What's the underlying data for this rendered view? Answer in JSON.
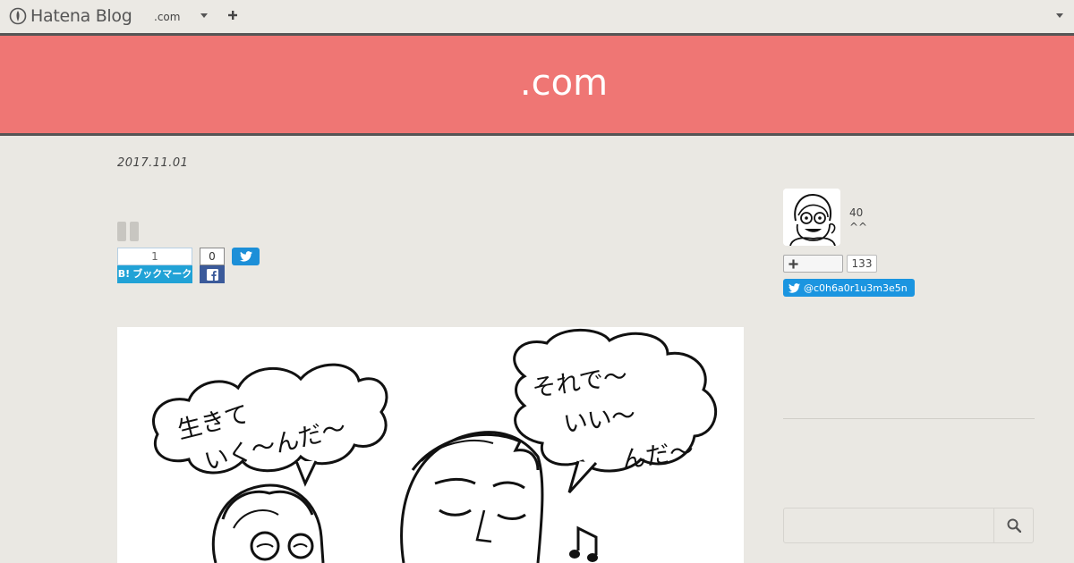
{
  "global_header": {
    "logo_text": "Hatena Blog",
    "blog_selector": ".com",
    "icons": [
      "hatena-logo-icon",
      "chevron-down-icon",
      "plus-icon",
      "chevron-down-icon"
    ]
  },
  "blog": {
    "title": ".com",
    "banner_color": "#ef7674"
  },
  "entry": {
    "date": "2017.11.01",
    "share": {
      "hatena_bookmark_count": "1",
      "hatena_bookmark_label": "ブックマーク",
      "hatena_bookmark_mark": "B!",
      "facebook_count": "0"
    },
    "illustration_texts": {
      "left_bubble": "生きていく〜んだ〜",
      "right_bubble": "それで〜いい〜んだ〜"
    }
  },
  "sidebar": {
    "profile": {
      "line1": "40",
      "line2": "^^"
    },
    "follow_count": "133",
    "twitter_handle": "@c0h6a0r1u3m3e5n",
    "search": {
      "placeholder": ""
    }
  },
  "colors": {
    "hatena_bookmark": "#21a2d6",
    "facebook": "#3b5a9a",
    "twitter": "#1b95e0"
  }
}
